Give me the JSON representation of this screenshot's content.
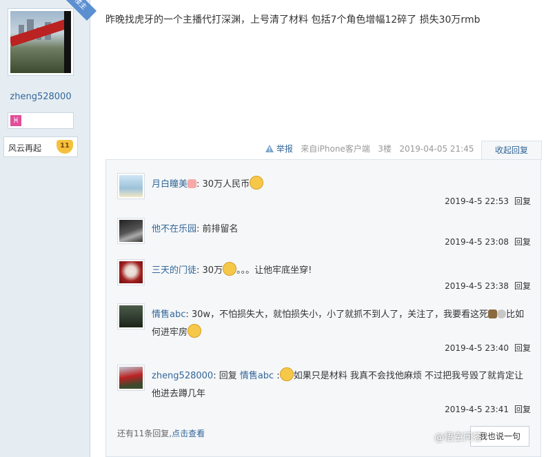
{
  "author": {
    "badge": "楼主",
    "username": "zheng528000",
    "zodiac_glyph": "♓",
    "level_name": "风云再起",
    "level_num": "11"
  },
  "post": {
    "text": "昨晚找虎牙的一个主播代打深渊，上号清了材料 包括7个角色增幅12碎了 损失30万rmb",
    "report_label": "举报",
    "source": "来自iPhone客户端",
    "floor": "3楼",
    "datetime": "2019-04-05 21:45",
    "collapse_label": "收起回复"
  },
  "replies": [
    {
      "name": "月白瞳美",
      "sep": ": ",
      "text": "30万人民币",
      "time": "2019-4-5 22:53",
      "reply": "回复"
    },
    {
      "name": "他不在乐园",
      "sep": ": ",
      "text": "前排留名",
      "time": "2019-4-5 23:08",
      "reply": "回复"
    },
    {
      "name": "三天的门徒",
      "sep": ": ",
      "text_a": "30万",
      "text_b": "。。。让他牢底坐穿!",
      "time": "2019-4-5 23:38",
      "reply": "回复"
    },
    {
      "name": "情售abc",
      "sep": ": ",
      "text_a": "30w，不怕损失大，就怕损失小，小了就抓不到人了，关注了，我要看这死",
      "text_b": "比如何进牢房",
      "time": "2019-4-5 23:40",
      "reply": "回复"
    },
    {
      "name": "zheng528000",
      "sep": ": ",
      "reply_word": "回复 ",
      "target": "情售abc",
      "colon": " :",
      "text_a": "如果只是材料 我真不会找他麻烦 不过把我号毁了就肯定让他进去蹲几年",
      "time": "2019-4-5 23:41",
      "reply": "回复"
    }
  ],
  "footer": {
    "more_prefix": "还有11条回复,",
    "more_link": "点击查看",
    "say_button": "我也说一句"
  },
  "watermark": "@悟空问答"
}
